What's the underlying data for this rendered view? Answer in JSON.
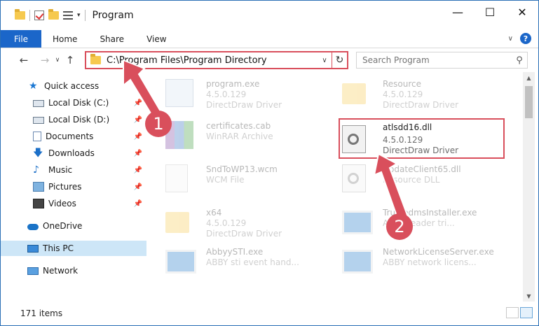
{
  "window": {
    "title": "Program"
  },
  "ribbon": {
    "tabs": [
      "File",
      "Home",
      "Share",
      "View"
    ]
  },
  "nav": {
    "address": "C:\\Program Files\\Program Directory",
    "search_placeholder": "Search Program"
  },
  "sidebar": {
    "items": [
      {
        "label": "Quick access",
        "icon": "star-icon",
        "pinned": false
      },
      {
        "label": "Local Disk (C:)",
        "icon": "disk-icon",
        "pinned": true
      },
      {
        "label": "Local Disk (D:)",
        "icon": "disk-icon",
        "pinned": true
      },
      {
        "label": "Documents",
        "icon": "document-icon",
        "pinned": true
      },
      {
        "label": "Downloads",
        "icon": "download-icon",
        "pinned": true
      },
      {
        "label": "Music",
        "icon": "music-icon",
        "pinned": true
      },
      {
        "label": "Pictures",
        "icon": "picture-icon",
        "pinned": true
      },
      {
        "label": "Videos",
        "icon": "video-icon",
        "pinned": true
      },
      {
        "label": "OneDrive",
        "icon": "cloud-icon",
        "pinned": false
      },
      {
        "label": "This PC",
        "icon": "computer-icon",
        "pinned": false,
        "selected": true
      },
      {
        "label": "Network",
        "icon": "network-icon",
        "pinned": false
      }
    ]
  },
  "files": [
    {
      "name": "program.exe",
      "line2": "4.5.0.129",
      "line3": "DirectDraw Driver",
      "type": "exe"
    },
    {
      "name": "Resource",
      "line2": "4.5.0.129",
      "line3": "DirectDraw Driver",
      "type": "folder"
    },
    {
      "name": "certificates.cab",
      "line2": "WinRAR Archive",
      "line3": "",
      "type": "rar"
    },
    {
      "name": "atlsdd16.dll",
      "line2": "4.5.0.129",
      "line3": "DirectDraw Driver",
      "type": "dll",
      "highlighted": true
    },
    {
      "name": "SndToWP13.wcm",
      "line2": "WCM File",
      "line3": "",
      "type": "file"
    },
    {
      "name": "UpdateClient65.dll",
      "line2": "Resource DLL",
      "line3": "",
      "type": "dll"
    },
    {
      "name": "x64",
      "line2": "4.5.0.129",
      "line3": "DirectDraw Driver",
      "type": "folder"
    },
    {
      "name": "TrustedmsInstaller.exe",
      "line2": "ABBY reader tri...",
      "line3": "",
      "type": "app"
    },
    {
      "name": "AbbyySTI.exe",
      "line2": "ABBY sti event hand...",
      "line3": "",
      "type": "app"
    },
    {
      "name": "NetworkLicenseServer.exe",
      "line2": "ABBY network licens...",
      "line3": "",
      "type": "app"
    }
  ],
  "annotations": {
    "step1": "1",
    "step2": "2",
    "color": "#d94f5c"
  },
  "status": {
    "count": "171 items"
  }
}
